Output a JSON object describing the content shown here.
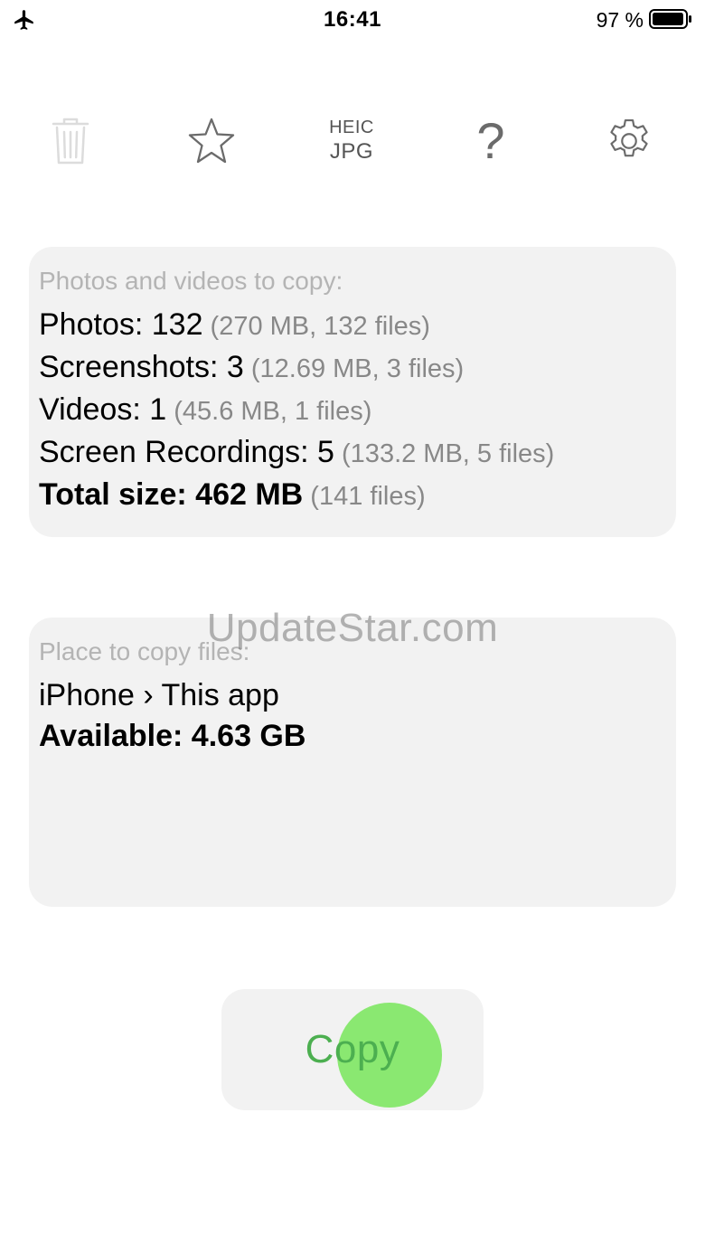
{
  "status_bar": {
    "time": "16:41",
    "battery_percent": "97 %",
    "battery_level": 0.97,
    "airplane_icon": "airplane-icon",
    "battery_icon": "battery-icon"
  },
  "toolbar": {
    "trash_icon": "trash-icon",
    "star_icon": "star-icon",
    "format_top": "HEIC",
    "format_bottom": "JPG",
    "help_label": "?",
    "settings_icon": "gear-icon"
  },
  "sources": {
    "heading": "Photos and videos to copy:",
    "rows": [
      {
        "label": "Photos: ",
        "value": "132",
        "meta": " (270 MB, 132 files)"
      },
      {
        "label": "Screenshots: ",
        "value": "3",
        "meta": " (12.69 MB, 3 files)"
      },
      {
        "label": "Videos: ",
        "value": "1",
        "meta": " (45.6 MB, 1 files)"
      },
      {
        "label": "Screen Recordings: ",
        "value": "5",
        "meta": " (133.2 MB, 5 files)"
      }
    ],
    "total": {
      "label": "Total size: ",
      "value": "462 MB",
      "meta": " (141 files)"
    }
  },
  "destination": {
    "heading": "Place to copy files:",
    "path": "iPhone › This app",
    "available": "Available: 4.63 GB"
  },
  "watermark": "UpdateStar.com",
  "copy_button": {
    "label": "Copy"
  },
  "colors": {
    "card_background": "#f2f2f2",
    "accent_green": "#4caf50",
    "tap_highlight": "#78e65a"
  }
}
